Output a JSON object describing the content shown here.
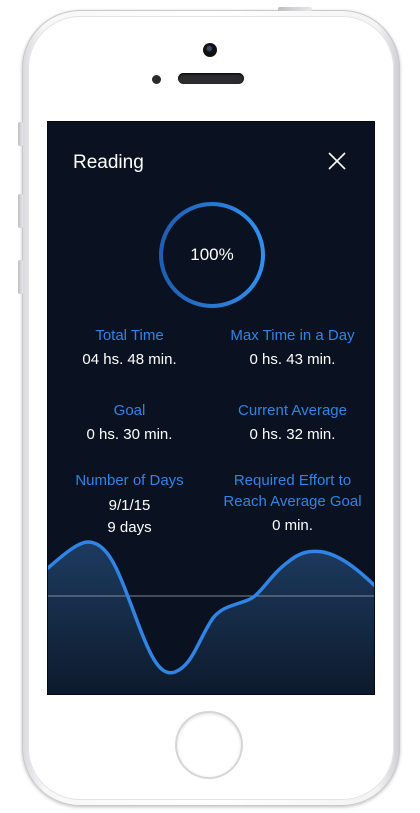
{
  "header": {
    "title": "Reading"
  },
  "progress": {
    "label": "100%",
    "value": 1.0
  },
  "stats": {
    "total_time": {
      "label": "Total Time",
      "value": "04 hs. 48 min."
    },
    "max_time": {
      "label": "Max Time in a Day",
      "value": "0 hs. 43 min."
    },
    "goal": {
      "label": "Goal",
      "value": "0 hs. 30 min."
    },
    "current_average": {
      "label": "Current Average",
      "value": "0 hs. 32 min."
    },
    "number_of_days": {
      "label": "Number of Days",
      "date": "9/1/15",
      "value": "9 days"
    },
    "required_effort": {
      "label_line1": "Required Effort to",
      "label_line2": "Reach Average Goal",
      "value": "0 min."
    }
  },
  "colors": {
    "background": "#0a1221",
    "accent": "#2f84e6",
    "text": "#ffffff"
  },
  "icons": {
    "close": "close-icon"
  }
}
